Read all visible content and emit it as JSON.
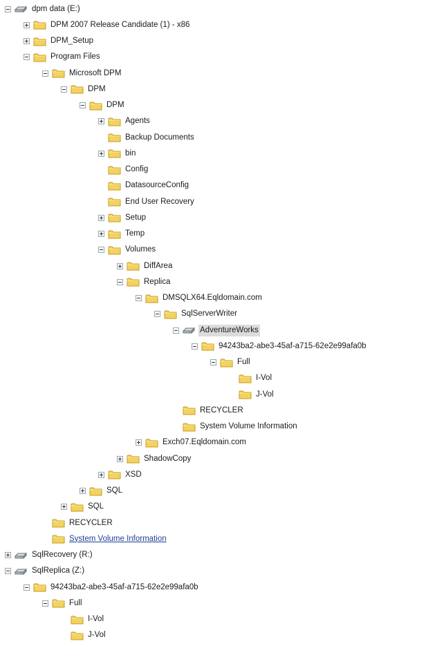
{
  "tree": [
    {
      "label": "dpm data (E:)",
      "depth": 0,
      "toggle": "minus",
      "icon": "drive-icon"
    },
    {
      "label": "DPM 2007 Release Candidate (1) - x86",
      "depth": 1,
      "toggle": "plus",
      "icon": "folder-icon"
    },
    {
      "label": "DPM_Setup",
      "depth": 1,
      "toggle": "plus",
      "icon": "folder-icon"
    },
    {
      "label": "Program Files",
      "depth": 1,
      "toggle": "minus",
      "icon": "folder-icon"
    },
    {
      "label": "Microsoft DPM",
      "depth": 2,
      "toggle": "minus",
      "icon": "folder-icon"
    },
    {
      "label": "DPM",
      "depth": 3,
      "toggle": "minus",
      "icon": "folder-icon"
    },
    {
      "label": "DPM",
      "depth": 4,
      "toggle": "minus",
      "icon": "folder-icon"
    },
    {
      "label": "Agents",
      "depth": 5,
      "toggle": "plus",
      "icon": "folder-icon"
    },
    {
      "label": "Backup Documents",
      "depth": 5,
      "toggle": "none",
      "icon": "folder-icon"
    },
    {
      "label": "bin",
      "depth": 5,
      "toggle": "plus",
      "icon": "folder-icon"
    },
    {
      "label": "Config",
      "depth": 5,
      "toggle": "none",
      "icon": "folder-icon"
    },
    {
      "label": "DatasourceConfig",
      "depth": 5,
      "toggle": "none",
      "icon": "folder-icon"
    },
    {
      "label": "End User Recovery",
      "depth": 5,
      "toggle": "none",
      "icon": "folder-icon"
    },
    {
      "label": "Setup",
      "depth": 5,
      "toggle": "plus",
      "icon": "folder-icon"
    },
    {
      "label": "Temp",
      "depth": 5,
      "toggle": "plus",
      "icon": "folder-icon"
    },
    {
      "label": "Volumes",
      "depth": 5,
      "toggle": "minus",
      "icon": "folder-icon"
    },
    {
      "label": "DiffArea",
      "depth": 6,
      "toggle": "plus",
      "icon": "folder-icon"
    },
    {
      "label": "Replica",
      "depth": 6,
      "toggle": "minus",
      "icon": "folder-icon"
    },
    {
      "label": "DMSQLX64.Eqldomain.com",
      "depth": 7,
      "toggle": "minus",
      "icon": "folder-icon"
    },
    {
      "label": "SqlServerWriter",
      "depth": 8,
      "toggle": "minus",
      "icon": "folder-icon"
    },
    {
      "label": "AdventureWorks",
      "depth": 9,
      "toggle": "minus",
      "icon": "drive-icon",
      "selected": true
    },
    {
      "label": "94243ba2-abe3-45af-a715-62e2e99afa0b",
      "depth": 10,
      "toggle": "minus",
      "icon": "folder-icon"
    },
    {
      "label": "Full",
      "depth": 11,
      "toggle": "minus",
      "icon": "folder-icon"
    },
    {
      "label": "I-Vol",
      "depth": 12,
      "toggle": "none",
      "icon": "folder-icon"
    },
    {
      "label": "J-Vol",
      "depth": 12,
      "toggle": "none",
      "icon": "folder-icon"
    },
    {
      "label": "RECYCLER",
      "depth": 9,
      "toggle": "none",
      "icon": "folder-icon"
    },
    {
      "label": "System Volume Information",
      "depth": 9,
      "toggle": "none",
      "icon": "folder-icon"
    },
    {
      "label": "Exch07.Eqldomain.com",
      "depth": 7,
      "toggle": "plus",
      "icon": "folder-icon"
    },
    {
      "label": "ShadowCopy",
      "depth": 6,
      "toggle": "plus",
      "icon": "folder-icon"
    },
    {
      "label": "XSD",
      "depth": 5,
      "toggle": "plus",
      "icon": "folder-icon"
    },
    {
      "label": "SQL",
      "depth": 4,
      "toggle": "plus",
      "icon": "folder-icon"
    },
    {
      "label": "SQL",
      "depth": 3,
      "toggle": "plus",
      "icon": "folder-icon"
    },
    {
      "label": "RECYCLER",
      "depth": 2,
      "toggle": "none",
      "icon": "folder-icon"
    },
    {
      "label": "System Volume Information",
      "depth": 2,
      "toggle": "none",
      "icon": "folder-icon",
      "link": true
    },
    {
      "label": "SqlRecovery (R:)",
      "depth": 0,
      "toggle": "plus",
      "icon": "drive-icon"
    },
    {
      "label": "SqlReplica (Z:)",
      "depth": 0,
      "toggle": "minus",
      "icon": "drive-icon"
    },
    {
      "label": "94243ba2-abe3-45af-a715-62e2e99afa0b",
      "depth": 1,
      "toggle": "minus",
      "icon": "folder-icon"
    },
    {
      "label": "Full",
      "depth": 2,
      "toggle": "minus",
      "icon": "folder-icon"
    },
    {
      "label": "I-Vol",
      "depth": 3,
      "toggle": "none",
      "icon": "folder-icon"
    },
    {
      "label": "J-Vol",
      "depth": 3,
      "toggle": "none",
      "icon": "folder-icon"
    }
  ],
  "colors": {
    "folder_fill": "#f3d25f",
    "folder_stroke": "#c49a1c",
    "drive_fill": "#b8bcc2",
    "drive_stroke": "#6d737b",
    "selected_bg": "#dcdcdc",
    "link_text": "#1f3f9a"
  }
}
